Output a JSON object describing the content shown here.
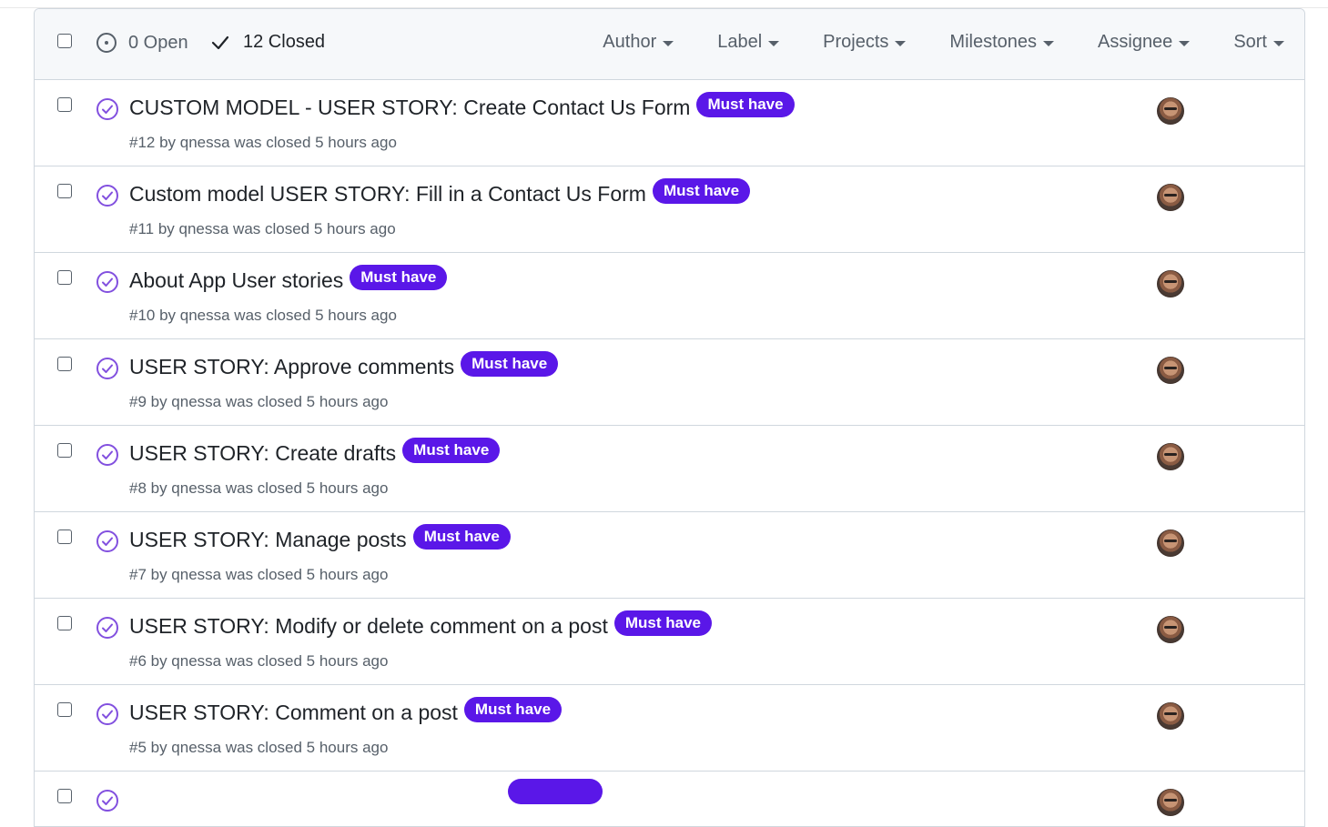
{
  "header": {
    "open_label": "0 Open",
    "closed_label": "12 Closed",
    "filters": [
      "Author",
      "Label",
      "Projects",
      "Milestones",
      "Assignee",
      "Sort"
    ]
  },
  "issues": [
    {
      "title": "CUSTOM MODEL - USER STORY: Create Contact Us Form",
      "label": "Must have",
      "meta": "#12 by qnessa was closed 5 hours ago"
    },
    {
      "title": "Custom model USER STORY: Fill in a Contact Us Form",
      "label": "Must have",
      "meta": "#11 by qnessa was closed 5 hours ago"
    },
    {
      "title": "About App User stories",
      "label": "Must have",
      "meta": "#10 by qnessa was closed 5 hours ago"
    },
    {
      "title": "USER STORY: Approve comments",
      "label": "Must have",
      "meta": "#9 by qnessa was closed 5 hours ago"
    },
    {
      "title": "USER STORY: Create drafts",
      "label": "Must have",
      "meta": "#8 by qnessa was closed 5 hours ago"
    },
    {
      "title": "USER STORY: Manage posts",
      "label": "Must have",
      "meta": "#7 by qnessa was closed 5 hours ago"
    },
    {
      "title": "USER STORY: Modify or delete comment on a post",
      "label": "Must have",
      "meta": "#6 by qnessa was closed 5 hours ago"
    },
    {
      "title": "USER STORY: Comment on a post",
      "label": "Must have",
      "meta": "#5 by qnessa was closed 5 hours ago"
    },
    {
      "title": "",
      "label": "",
      "meta": ""
    }
  ],
  "colors": {
    "label_bg": "#5a17e8",
    "closed_icon": "#8250df",
    "border": "#d0d7de"
  },
  "icons": {
    "open": "issue-opened-icon",
    "closed": "check-icon",
    "issue_closed": "issue-closed-icon"
  }
}
